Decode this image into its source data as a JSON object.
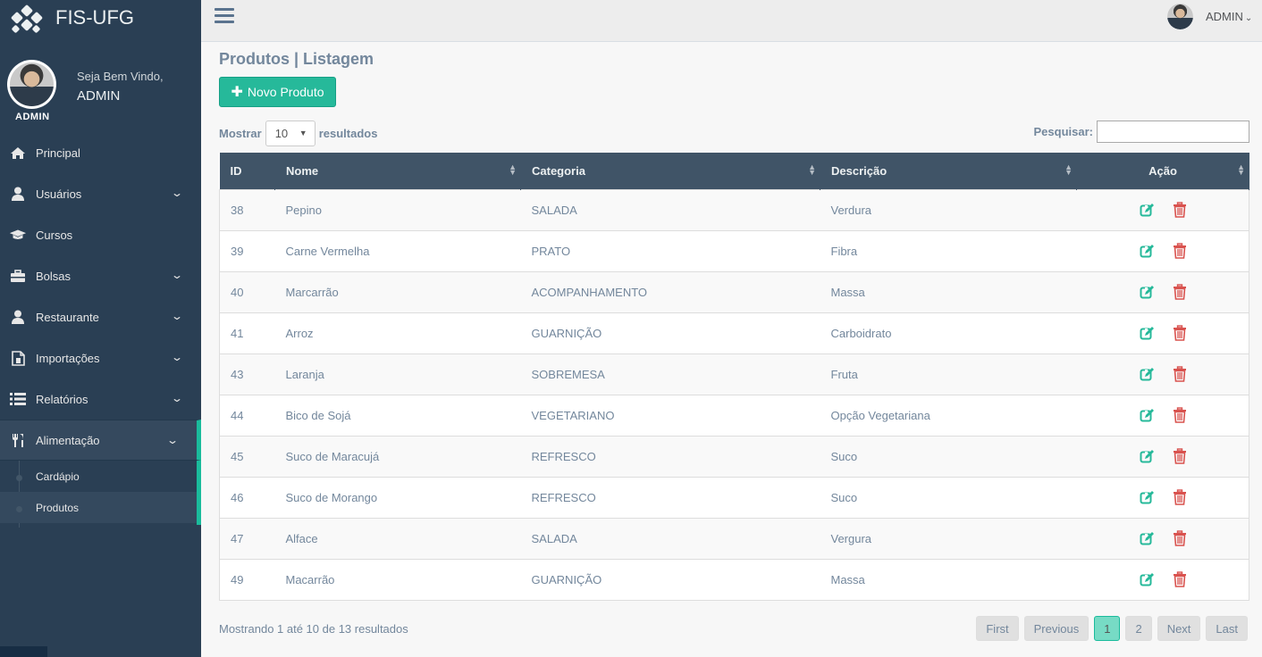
{
  "brand": {
    "title": "FIS-UFG"
  },
  "profile": {
    "welcome": "Seja Bem Vindo,",
    "name": "ADMIN",
    "badge": "ADMIN"
  },
  "menu": [
    {
      "label": "Principal",
      "icon": "home-icon",
      "has_children": false
    },
    {
      "label": "Usuários",
      "icon": "user-icon",
      "has_children": true
    },
    {
      "label": "Cursos",
      "icon": "graduation-cap-icon",
      "has_children": false
    },
    {
      "label": "Bolsas",
      "icon": "briefcase-icon",
      "has_children": true
    },
    {
      "label": "Restaurante",
      "icon": "user-icon",
      "has_children": true
    },
    {
      "label": "Importações",
      "icon": "file-icon",
      "has_children": true
    },
    {
      "label": "Relatórios",
      "icon": "list-icon",
      "has_children": true
    },
    {
      "label": "Alimentação",
      "icon": "cutlery-icon",
      "has_children": true,
      "active": true
    }
  ],
  "submenu": [
    {
      "label": "Cardápio"
    },
    {
      "label": "Produtos",
      "current": true
    }
  ],
  "topnav": {
    "user": "ADMIN"
  },
  "page": {
    "title": "Produtos | Listagem",
    "new_button": "Novo Produto"
  },
  "table_controls": {
    "show_label": "Mostrar",
    "show_value": "10",
    "results_label": "resultados",
    "search_label": "Pesquisar:"
  },
  "table": {
    "columns": [
      "ID",
      "Nome",
      "Categoria",
      "Descrição",
      "Ação"
    ],
    "rows": [
      [
        "38",
        "Pepino",
        "SALADA",
        "Verdura"
      ],
      [
        "39",
        "Carne Vermelha",
        "PRATO",
        "Fibra"
      ],
      [
        "40",
        "Marcarrão",
        "ACOMPANHAMENTO",
        "Massa"
      ],
      [
        "41",
        "Arroz",
        "GUARNIÇÃO",
        "Carboidrato"
      ],
      [
        "43",
        "Laranja",
        "SOBREMESA",
        "Fruta"
      ],
      [
        "44",
        "Bico de Sojá",
        "VEGETARIANO",
        "Opção Vegetariana"
      ],
      [
        "45",
        "Suco de Maracujá",
        "REFRESCO",
        "Suco"
      ],
      [
        "46",
        "Suco de Morango",
        "REFRESCO",
        "Suco"
      ],
      [
        "47",
        "Alface",
        "SALADA",
        "Vergura"
      ],
      [
        "49",
        "Macarrão",
        "GUARNIÇÃO",
        "Massa"
      ]
    ]
  },
  "footer": {
    "info": "Mostrando 1 até 10 de 13 resultados",
    "pagination": [
      "First",
      "Previous",
      "1",
      "2",
      "Next",
      "Last"
    ],
    "current_page": "1"
  },
  "colors": {
    "sidebar": "#2a3f54",
    "accent": "#1abb9c",
    "button": "#26b99a",
    "delete": "#d9534f",
    "table_header": "#405467"
  }
}
